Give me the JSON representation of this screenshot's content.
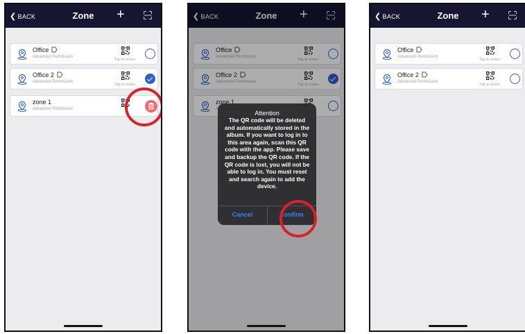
{
  "header": {
    "back_label": "BACK",
    "title": "Zone"
  },
  "card_common": {
    "subtitle": "Advanced Permission",
    "share_label": "Tap to share"
  },
  "screen1": {
    "cards": [
      {
        "name": "Office"
      },
      {
        "name": "Office 2"
      },
      {
        "name": "zone 1"
      }
    ]
  },
  "screen2": {
    "cards": [
      {
        "name": "Office"
      },
      {
        "name": "Office 2"
      },
      {
        "name": "zone 1"
      }
    ],
    "dialog": {
      "title": "Attention",
      "message": "The QR code will be deleted and automatically stored in the album. If you want to log in to this area again, scan this QR code with the app. Please save and backup the QR code. If the QR code is lost, you will not be able to log in. You must reset and search again to add the device.",
      "cancel_label": "Cancel",
      "confirm_label": "Confirm"
    }
  },
  "screen3": {
    "cards": [
      {
        "name": "Office"
      },
      {
        "name": "Office 2"
      }
    ]
  },
  "colors": {
    "header": "#161633",
    "accent": "#2f5fc9",
    "highlight": "#d6222a",
    "delete": "#ef6a6a"
  },
  "icons": [
    "chevron-left-icon",
    "plus-icon",
    "scan-icon",
    "location-user-icon",
    "rename-icon",
    "qr-code-icon",
    "check-icon",
    "trash-icon"
  ]
}
